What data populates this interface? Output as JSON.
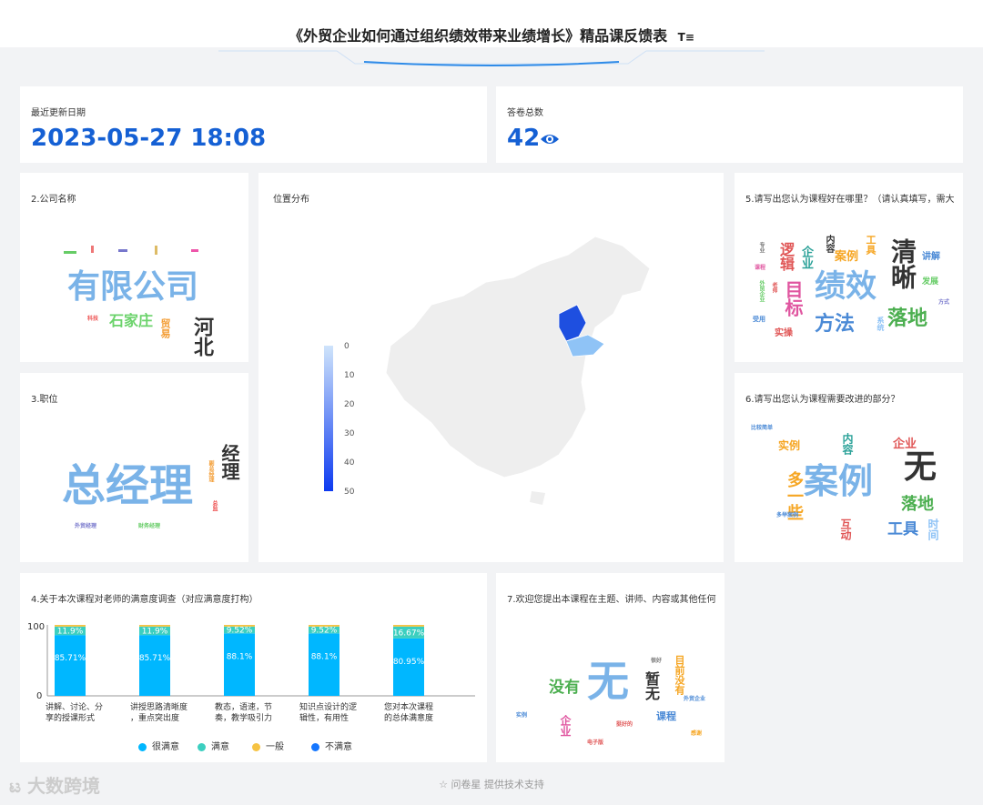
{
  "header": {
    "title": "《外贸企业如何通过组织绩效带来业绩增长》精品课反馈表",
    "filter_icon": "filter-icon"
  },
  "kpi": {
    "update": {
      "label": "最近更新日期",
      "value": "2023-05-27 18:08"
    },
    "total": {
      "label": "答卷总数",
      "value": "42",
      "icon": "eye-icon"
    }
  },
  "company": {
    "title": "2.公司名称",
    "words": [
      "有限公司",
      "石家庄",
      "河北",
      "贸易",
      "科技"
    ]
  },
  "position": {
    "title": "3.职位",
    "words": [
      "总经理",
      "经理",
      "外贸经理",
      "财务经理",
      "副总经理",
      "总监"
    ]
  },
  "map": {
    "title": "位置分布",
    "legend": [
      "0",
      "10",
      "20",
      "30",
      "40",
      "50"
    ]
  },
  "good": {
    "title": "5.请写出您认为课程好在哪里？（请认真填写，需大",
    "words": [
      "绩效",
      "清晰",
      "方法",
      "落地",
      "目标",
      "逻辑",
      "案例",
      "企业",
      "工具",
      "讲解",
      "内容",
      "发展",
      "实操",
      "系统",
      "外贸企业",
      "受用",
      "课程",
      "方式",
      "老师",
      "专业"
    ]
  },
  "improve": {
    "title": "6.请写出您认为课程需要改进的部分？",
    "words": [
      "案例",
      "无",
      "多一些",
      "落地",
      "工具",
      "企业",
      "实例",
      "内容",
      "互动",
      "时间",
      "比较简单",
      "多举案例"
    ]
  },
  "satisfaction": {
    "title": "4.关于本次课程对老师的满意度调查（对应满意度打构）",
    "y_ticks": [
      "100",
      "0"
    ],
    "legend": [
      "很满意",
      "满意",
      "一般",
      "不满意"
    ]
  },
  "other": {
    "title": "7.欢迎您提出本课程在主题、讲师、内容或其他任何",
    "words": [
      "无",
      "没有",
      "暂无",
      "目前没有",
      "课程",
      "企业",
      "实例",
      "挺好的",
      "很好",
      "外贸企业",
      "电子版",
      "感谢"
    ]
  },
  "footer": {
    "text": "问卷星 提供技术支持",
    "brand": "大数跨境"
  },
  "chart_data": {
    "type": "bar",
    "stacked": true,
    "categories": [
      "讲解、讨论、分享的授课形式",
      "讲授思路清晰度，重点突出度",
      "教态，语速，节奏，教学吸引力",
      "知识点设计的逻辑性，有用性",
      "您对本次课程的总体满意度"
    ],
    "series": [
      {
        "name": "很满意",
        "values": [
          85.71,
          85.71,
          88.1,
          88.1,
          80.95
        ],
        "labels": [
          "85.71%",
          "85.71%",
          "88.1%",
          "88.1%",
          "80.95%"
        ],
        "color": "#00b7ff"
      },
      {
        "name": "满意",
        "values": [
          11.9,
          11.9,
          9.52,
          9.52,
          16.67
        ],
        "labels": [
          "11.9%",
          "11.9%",
          "9.52%",
          "9.52%",
          "16.67%"
        ],
        "color": "#3ccfc0"
      },
      {
        "name": "一般",
        "values": [
          2.39,
          2.39,
          2.38,
          2.38,
          2.38
        ],
        "color": "#f6c343"
      },
      {
        "name": "不满意",
        "values": [
          0,
          0,
          0,
          0,
          0
        ],
        "color": "#1677ff"
      }
    ],
    "ylim": [
      0,
      100
    ]
  }
}
